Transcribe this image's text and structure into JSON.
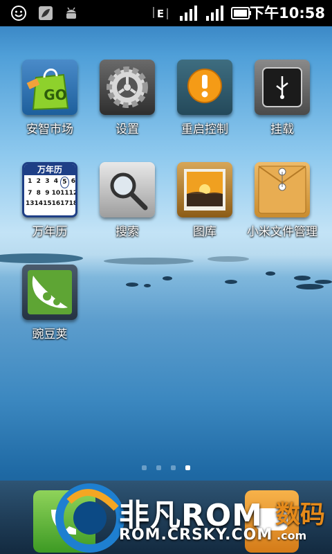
{
  "status_bar": {
    "time": "下午10:58",
    "network_type": "E",
    "icons": [
      "smiley-icon",
      "leaf-notification-icon",
      "android-debug-icon",
      "data-activity-icon",
      "signal-1-icon",
      "signal-2-icon",
      "battery-icon"
    ]
  },
  "apps": [
    {
      "label": "安智市场",
      "icon": "go-shopping-bag-icon",
      "badge": "GO"
    },
    {
      "label": "设置",
      "icon": "gear-icon"
    },
    {
      "label": "重启控制",
      "icon": "exclamation-icon"
    },
    {
      "label": "挂载",
      "icon": "usb-icon"
    },
    {
      "label": "万年历",
      "icon": "calendar-icon",
      "calendar_title": "万年历"
    },
    {
      "label": "搜索",
      "icon": "magnifier-icon"
    },
    {
      "label": "图库",
      "icon": "gallery-sunset-icon"
    },
    {
      "label": "小米文件管理",
      "icon": "envelope-folder-icon"
    },
    {
      "label": "豌豆荚",
      "icon": "pea-pod-icon"
    }
  ],
  "calendar_days": [
    "1",
    "2",
    "3",
    "4",
    "5",
    "6",
    "7",
    "8",
    "9",
    "10",
    "11",
    "12",
    "13",
    "14",
    "15",
    "16",
    "17",
    "18"
  ],
  "pages": {
    "count": 4,
    "current": 4
  },
  "dock": {
    "phone_icon": "phone-icon",
    "messages_icon": "messages-icon"
  },
  "watermark": {
    "title": "非凡ROM",
    "url": "ROM.CRSKY.COM",
    "side_text": "数码",
    "side_domain": ".com"
  },
  "colors": {
    "status_bar": "#000000",
    "app_label": "#ffffff",
    "page_dot_active": "#ffffff",
    "phone_green": "#5cb53a",
    "watermark_orange": "#e58a1a"
  }
}
